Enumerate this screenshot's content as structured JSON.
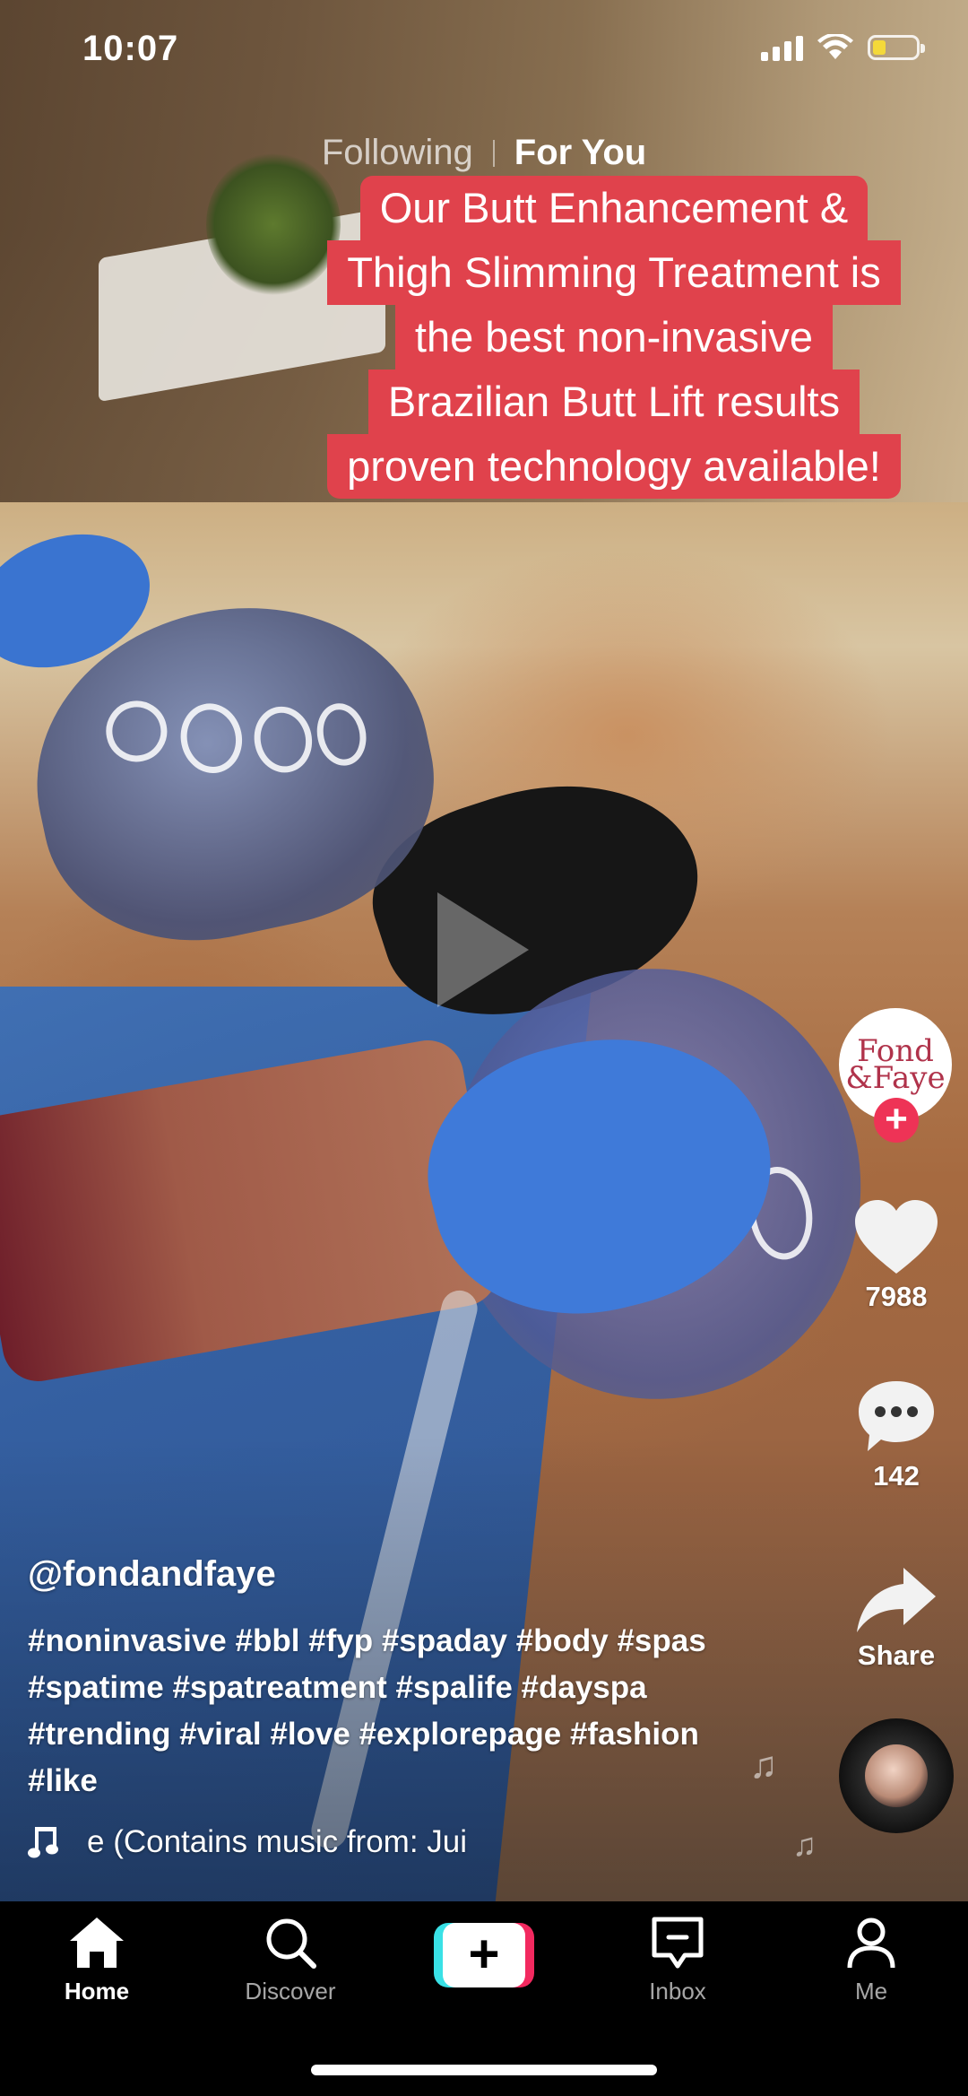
{
  "status_bar": {
    "time": "10:07"
  },
  "top_tabs": {
    "following": "Following",
    "for_you": "For You"
  },
  "caption": [
    "Our Butt Enhancement &",
    "Thigh Slimming Treatment is",
    "the best non-invasive",
    "Brazilian Butt Lift results",
    "proven technology available!"
  ],
  "creator": {
    "username": "@fondandfaye",
    "avatar_text_1": "Fond",
    "avatar_text_2": "&Faye",
    "follow_symbol": "+"
  },
  "description": [
    "#noninvasive #bbl #fyp #spaday #body #spas",
    "#spatime #spatreatment #spalife #dayspa",
    "#trending #viral #love #explorepage #fashion",
    "#like"
  ],
  "music": {
    "text": "e (Contains music from: Jui",
    "icon": "music-note-icon"
  },
  "actions": {
    "likes": "7988",
    "comments": "142",
    "share_label": "Share"
  },
  "nav": {
    "home": "Home",
    "discover": "Discover",
    "create_symbol": "+",
    "inbox": "Inbox",
    "me": "Me"
  },
  "colors": {
    "caption_bg": "#e0424c",
    "follow_plus": "#ee3356",
    "create_cyan": "#39e1e6",
    "create_red": "#f2295f",
    "battery_level": "#f4d93a"
  },
  "battery_level_fraction": 0.3
}
